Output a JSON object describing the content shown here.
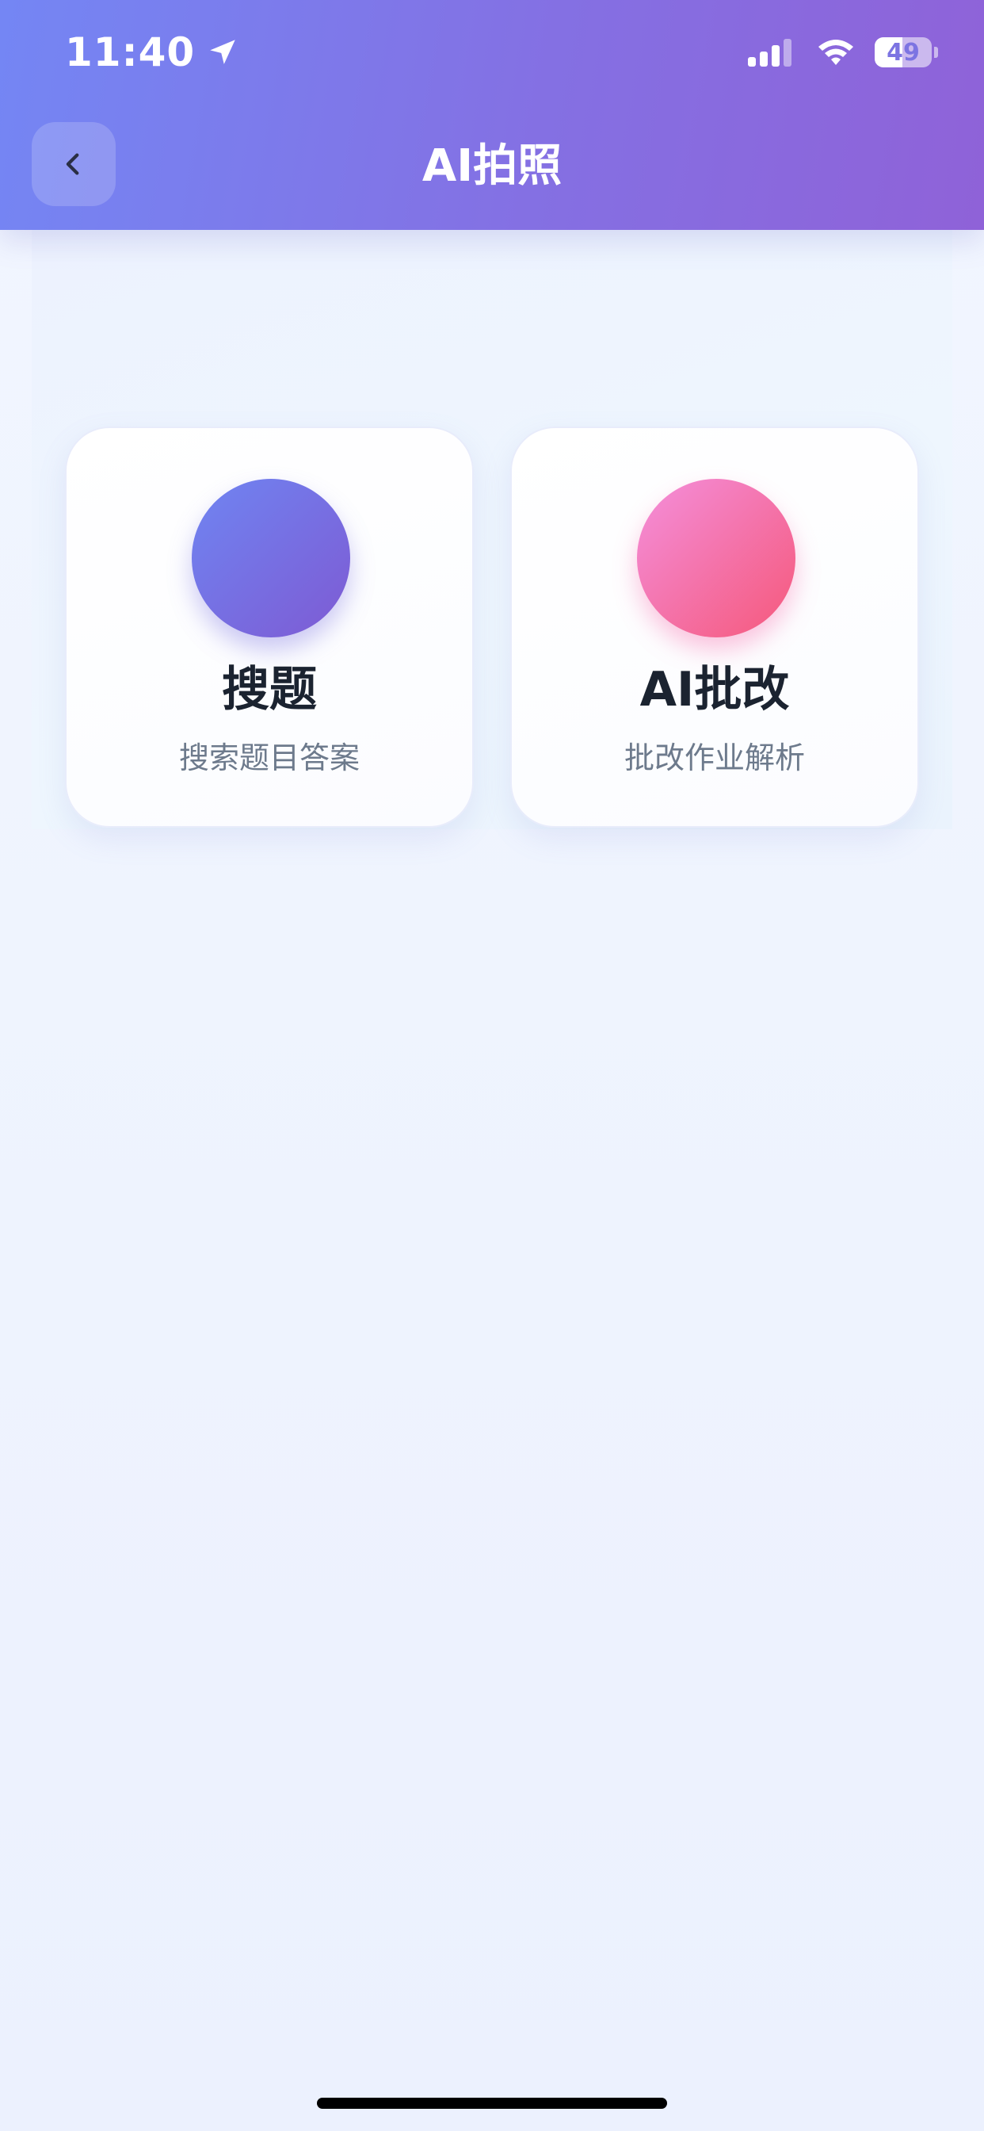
{
  "status_bar": {
    "time": "11:40",
    "battery": "49",
    "battery_level": 0.49,
    "location_icon": "location-arrow-icon",
    "signal_icon": "cellular-signal-icon",
    "wifi_icon": "wifi-icon"
  },
  "nav": {
    "title": "AI拍照",
    "back_icon": "chevron-left-icon"
  },
  "cards": [
    {
      "title": "搜题",
      "subtitle": "搜索题目答案",
      "accent_from": "#6f85f2",
      "accent_to": "#7e5ad3"
    },
    {
      "title": "AI批改",
      "subtitle": "批改作业解析",
      "accent_from": "#f48fdc",
      "accent_to": "#f5587a"
    }
  ],
  "colors": {
    "header_from": "#7486f4",
    "header_to": "#8f62d8",
    "title_text": "#1b2330",
    "subtitle_text": "#6d7a8c"
  }
}
